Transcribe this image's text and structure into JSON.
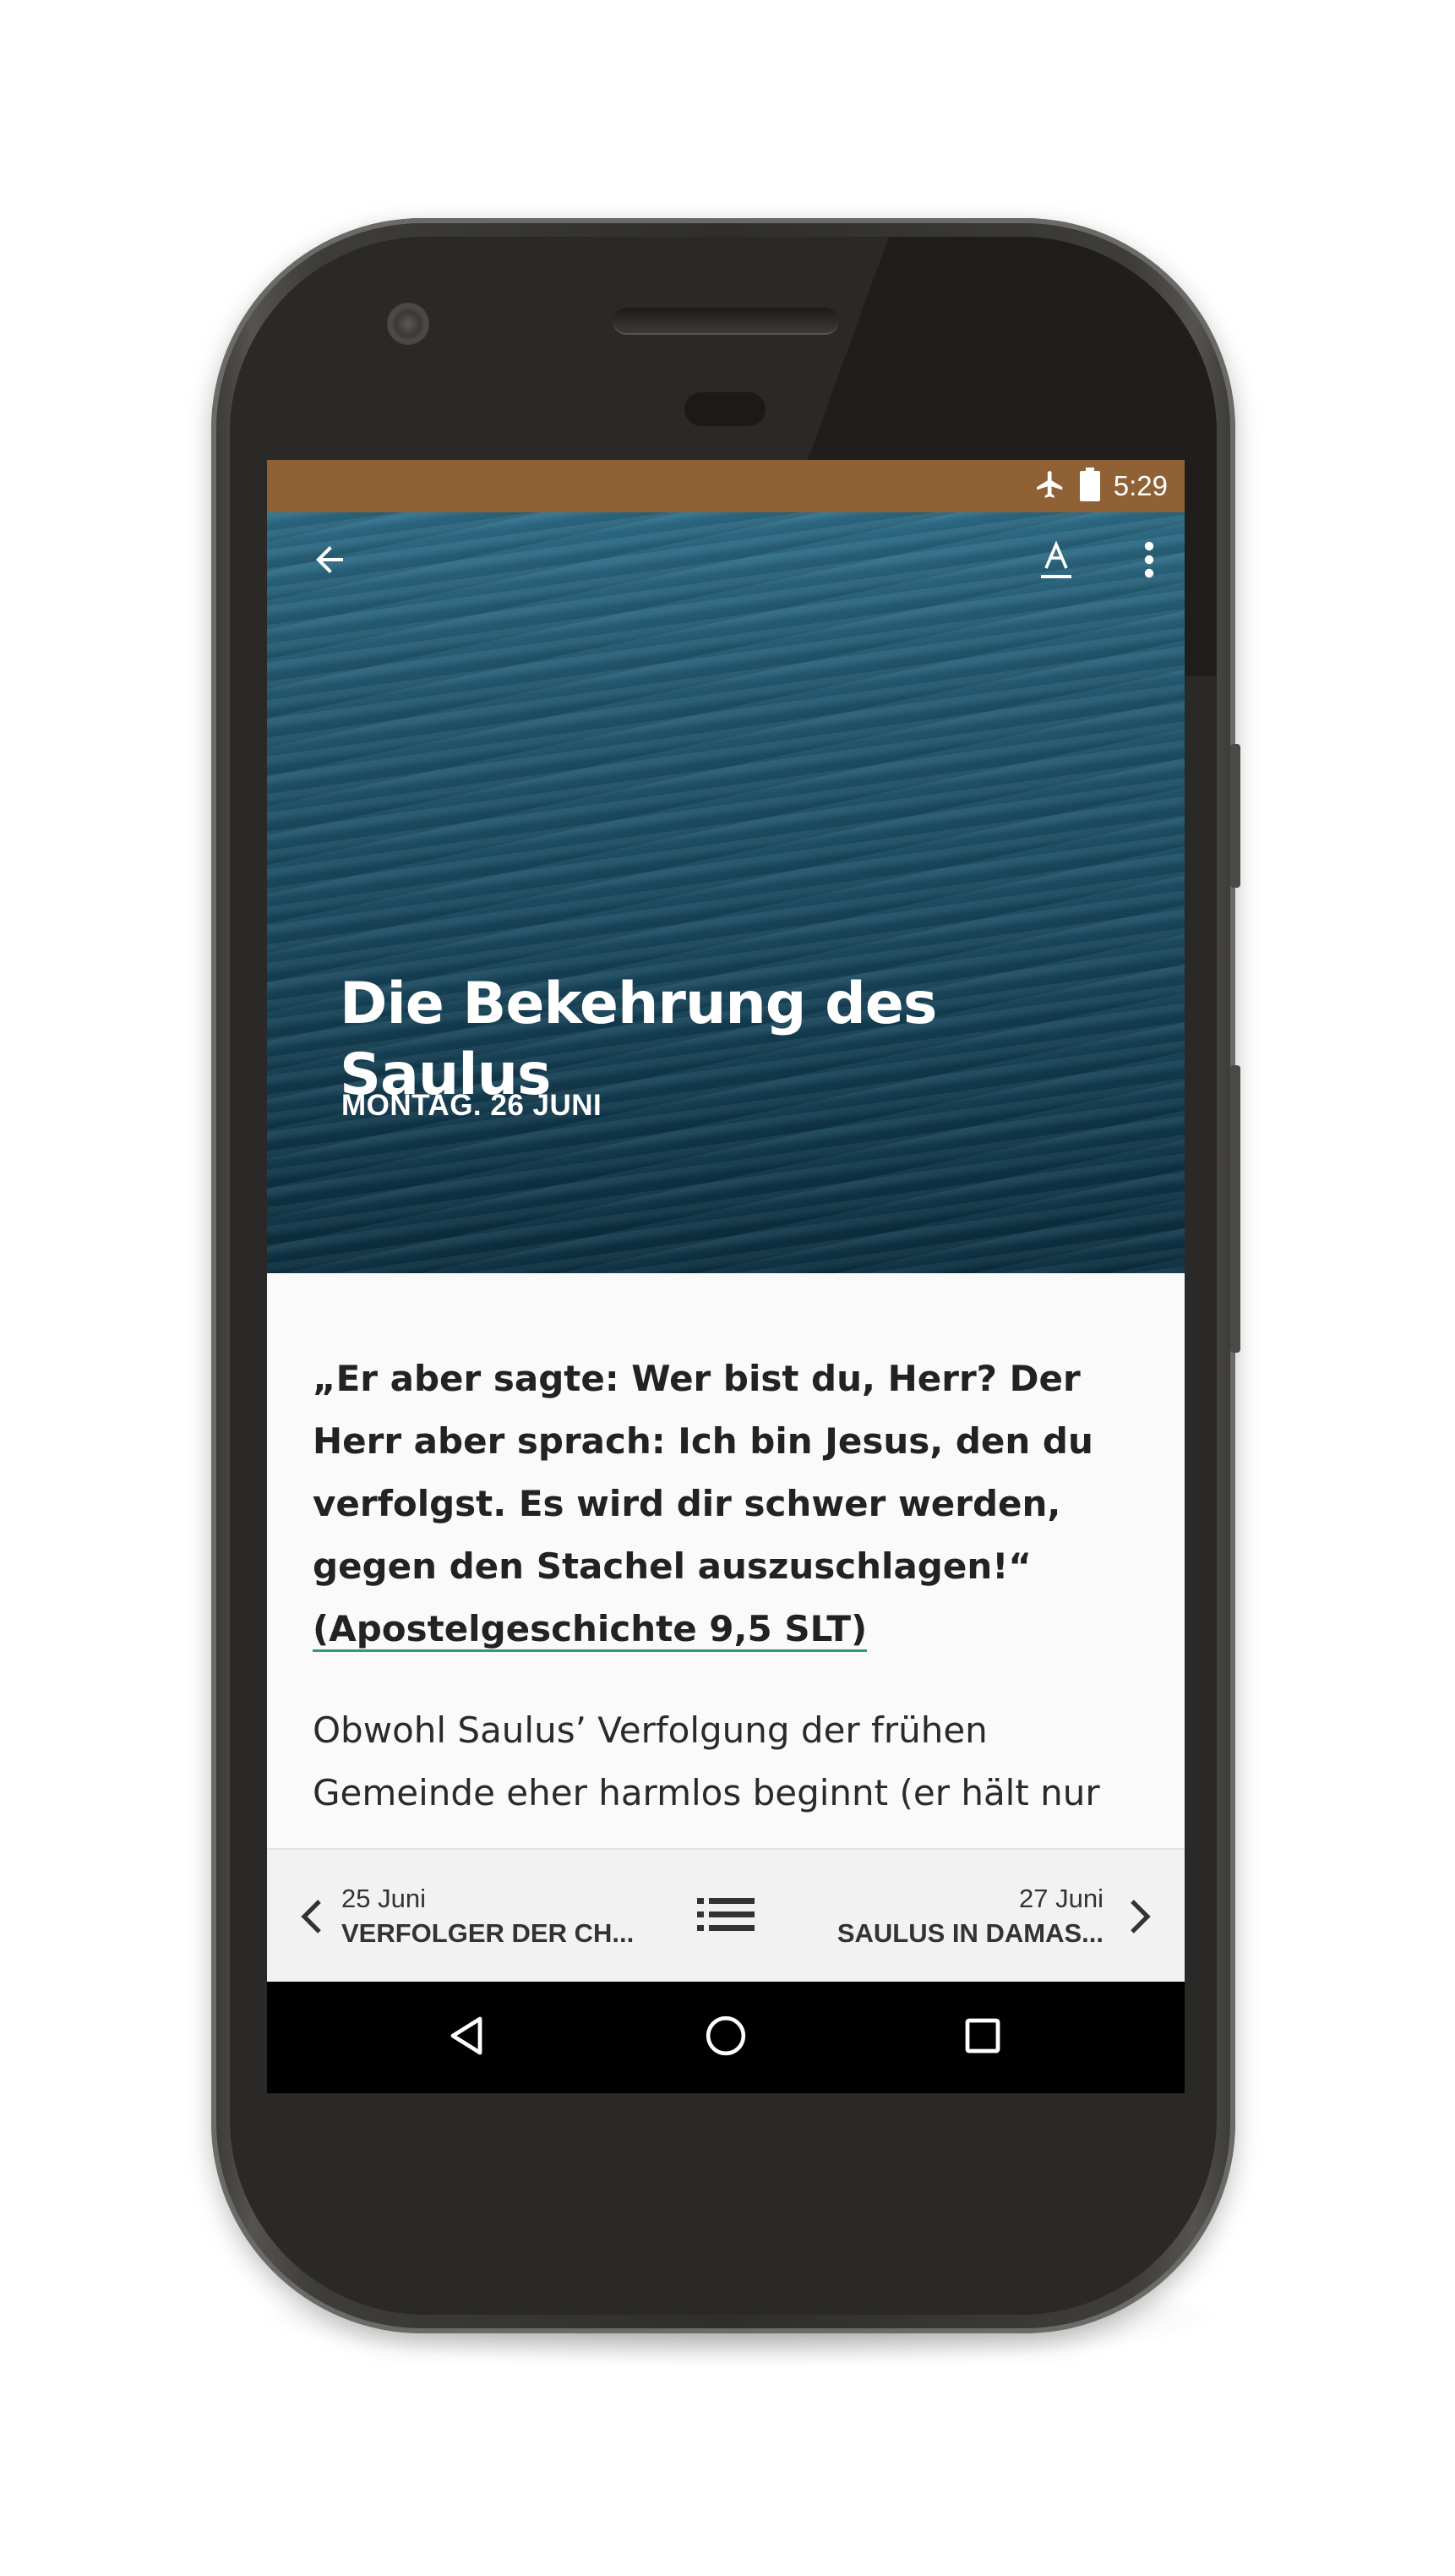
{
  "colors": {
    "status_bar": "#8f6134",
    "link_underline": "#2e9b74",
    "hero_sea": "#1a4a60"
  },
  "status_bar": {
    "icons": [
      "airplane-mode-icon",
      "battery-icon"
    ],
    "time": "5:29"
  },
  "toolbar": {
    "icons": [
      "back-arrow-icon",
      "text-format-icon",
      "more-vert-icon"
    ]
  },
  "hero": {
    "title": "Die Bekehrung des Saulus",
    "date": "MONTAG. 26 JUNI"
  },
  "article": {
    "quote_text": "„Er aber sagte: Wer bist du, Herr? Der Herr aber sprach: Ich bin Jesus, den du verfolgst. Es wird dir schwer werden, gegen den Stachel auszuschlagen!“ ",
    "quote_ref": "(Apostelgeschichte 9,5 SLT)",
    "body": "Obwohl Saulus’ Verfolgung der frühen Gemeinde eher harmlos beginnt (er hält nur"
  },
  "bottom_nav": {
    "prev": {
      "date": "25 Juni",
      "title": "VERFOLGER DER CH..."
    },
    "next": {
      "date": "27 Juni",
      "title": "SAULUS IN DAMAS..."
    },
    "icons": [
      "chevron-left-icon",
      "list-icon",
      "chevron-right-icon"
    ]
  },
  "system_nav": {
    "icons": [
      "back-triangle-icon",
      "home-circle-icon",
      "recents-square-icon"
    ]
  }
}
